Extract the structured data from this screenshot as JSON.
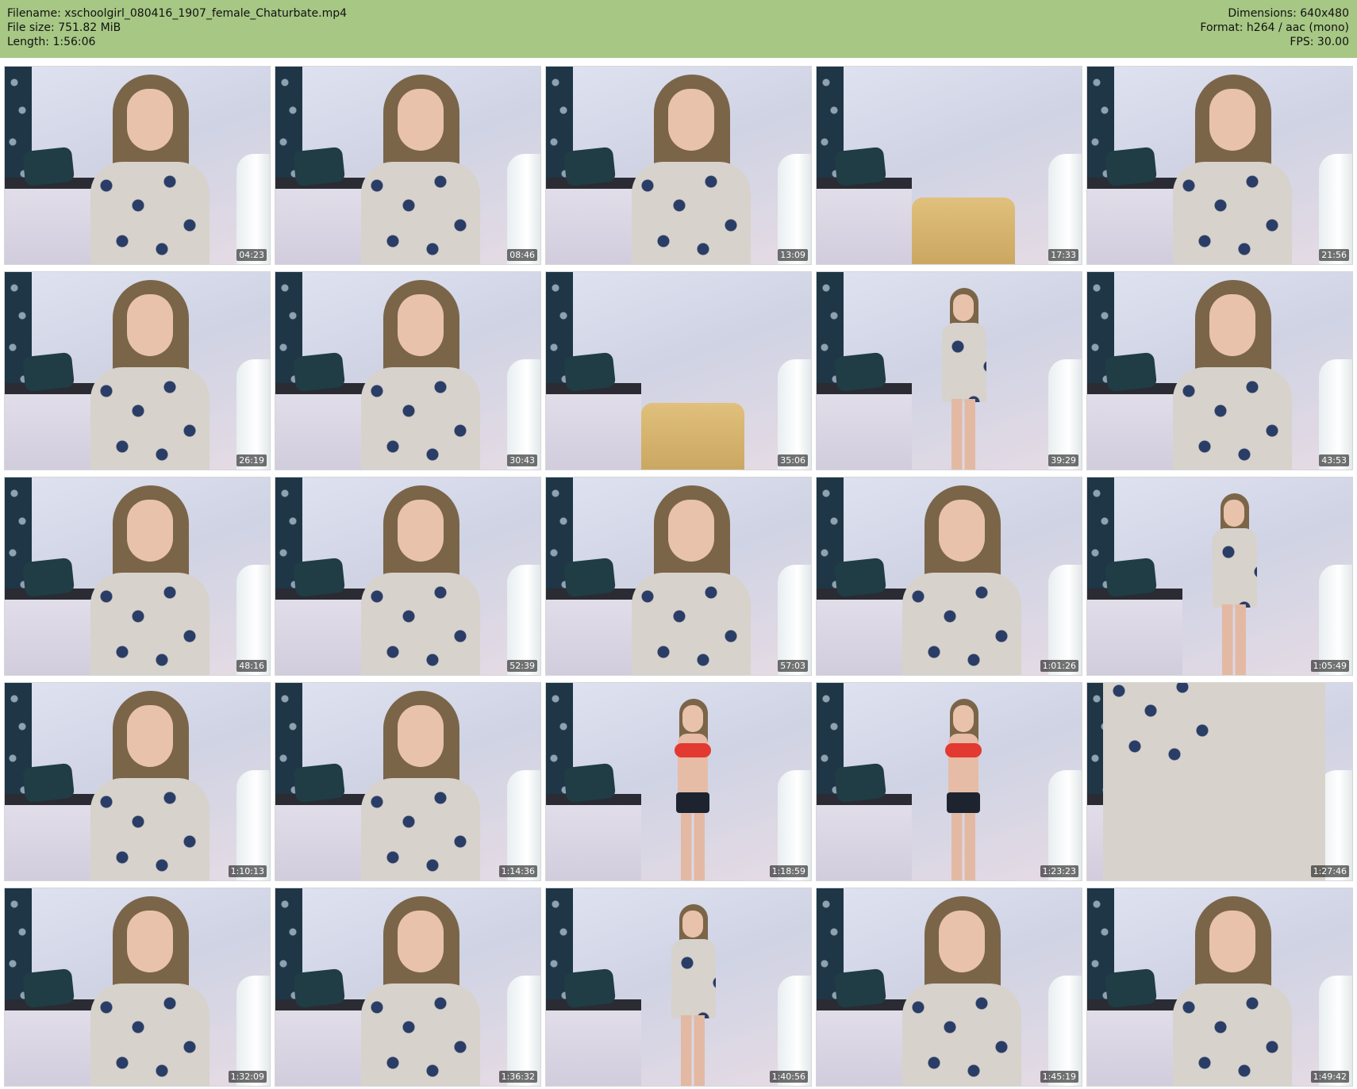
{
  "header": {
    "filename_label": "Filename: xschoolgirl_080416_1907_female_Chaturbate.mp4",
    "filesize_label": "File size: 751.82 MiB",
    "length_label": "Length: 1:56:06",
    "dimensions_label": "Dimensions: 640x480",
    "format_label": "Format: h264 / aac (mono)",
    "fps_label": "FPS: 30.00"
  },
  "colors": {
    "header_bg": "#a7c785",
    "thumb_border": "#d6d6d6"
  },
  "thumbnails": [
    {
      "time": "04:23",
      "scene": "woman-closeup"
    },
    {
      "time": "08:46",
      "scene": "woman-seated"
    },
    {
      "time": "13:09",
      "scene": "woman-seated"
    },
    {
      "time": "17:33",
      "scene": "empty-chair"
    },
    {
      "time": "21:56",
      "scene": "woman-closeup"
    },
    {
      "time": "26:19",
      "scene": "woman-closeup"
    },
    {
      "time": "30:43",
      "scene": "woman-seated"
    },
    {
      "time": "35:06",
      "scene": "empty-chair"
    },
    {
      "time": "39:29",
      "scene": "woman-standing"
    },
    {
      "time": "43:53",
      "scene": "woman-closeup"
    },
    {
      "time": "48:16",
      "scene": "woman-seated"
    },
    {
      "time": "52:39",
      "scene": "woman-closeup"
    },
    {
      "time": "57:03",
      "scene": "woman-closeup"
    },
    {
      "time": "1:01:26",
      "scene": "woman-closeup"
    },
    {
      "time": "1:05:49",
      "scene": "woman-standing"
    },
    {
      "time": "1:10:13",
      "scene": "woman-closeup"
    },
    {
      "time": "1:14:36",
      "scene": "woman-closeup"
    },
    {
      "time": "1:18:59",
      "scene": "woman-bikini"
    },
    {
      "time": "1:23:23",
      "scene": "woman-bikini"
    },
    {
      "time": "1:27:46",
      "scene": "shirt-closeup"
    },
    {
      "time": "1:32:09",
      "scene": "woman-seated"
    },
    {
      "time": "1:36:32",
      "scene": "woman-closeup"
    },
    {
      "time": "1:40:56",
      "scene": "woman-standing"
    },
    {
      "time": "1:45:19",
      "scene": "woman-closeup"
    },
    {
      "time": "1:49:42",
      "scene": "woman-closeup"
    }
  ]
}
